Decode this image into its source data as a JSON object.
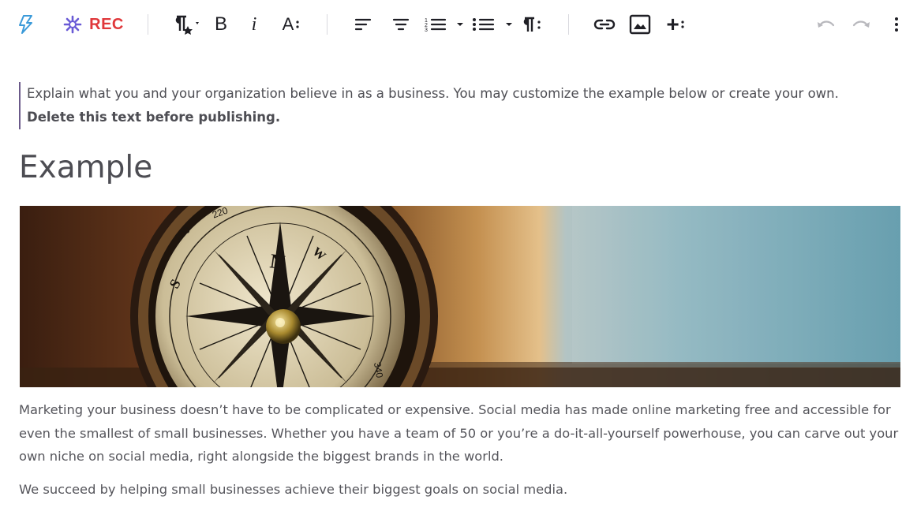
{
  "toolbar": {
    "rec_label": "REC",
    "font_size_glyph": "A",
    "bold_glyph": "B",
    "italic_glyph": "i",
    "plus_glyph": "+",
    "buttons": [
      "lightning-icon",
      "rec-icon",
      "paragraph-style-icon",
      "bold-icon",
      "italic-icon",
      "font-size-icon",
      "align-left-icon",
      "align-center-icon",
      "ordered-list-icon",
      "unordered-list-icon",
      "paragraph-format-icon",
      "link-icon",
      "image-icon",
      "insert-more-icon",
      "undo-icon",
      "redo-icon",
      "more-options-icon"
    ]
  },
  "hint": {
    "line1": "Explain what you and your organization believe in as a business. You may customize the example below or create your own.",
    "line2": "Delete this text before publishing."
  },
  "heading": "Example",
  "paragraphs": {
    "p1": "Marketing your business doesn’t have to be complicated or expensive. Social media has made online marketing free and accessible for even the smallest of small businesses. Whether you have a team of 50 or you’re a do-it-all-yourself powerhouse, you can carve out your own niche on social media, right alongside the biggest brands in the world.",
    "p2": "We succeed by helping small businesses achieve their biggest goals on social media."
  },
  "hero_image": {
    "description_name": "compass-hero-image"
  },
  "colors": {
    "accent_lightning": "#3b9ad9",
    "rec_red": "#e0373a",
    "rec_star": "#6a5bd6",
    "hint_bar": "#6b5a8a",
    "disabled": "#b8b8bd"
  }
}
